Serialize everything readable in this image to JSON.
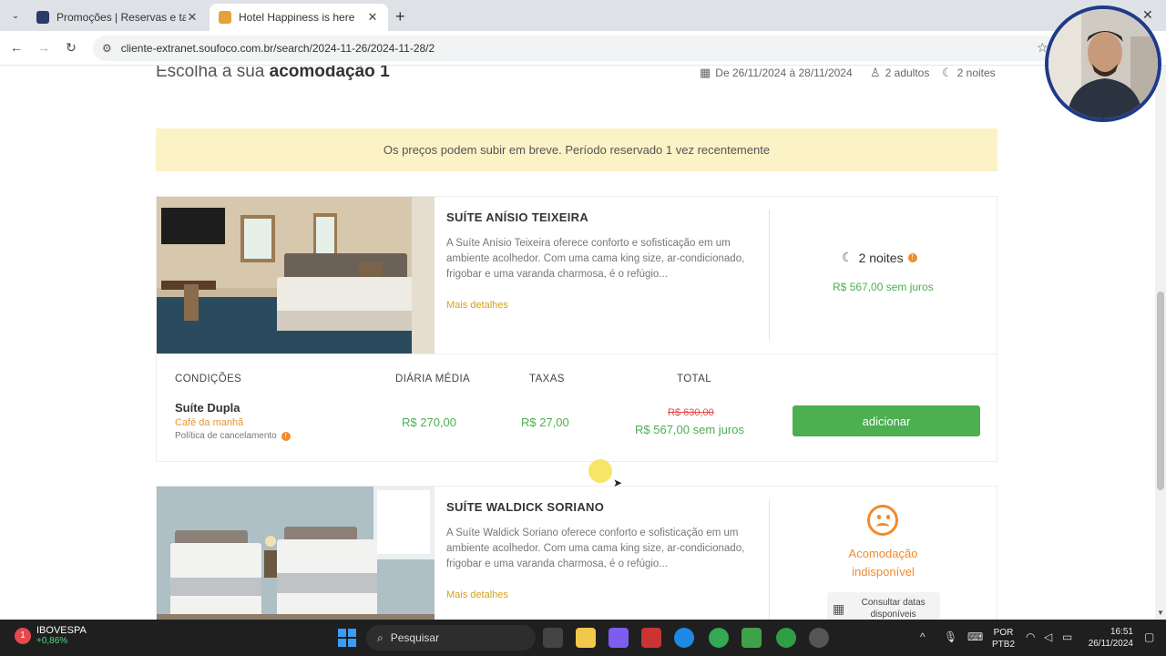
{
  "browser": {
    "tabs": [
      {
        "title": "Promoções | Reservas e tarifas",
        "active": false
      },
      {
        "title": "Hotel Happiness is here",
        "active": true
      }
    ],
    "url": "cliente-extranet.soufoco.com.br/search/2024-11-26/2024-11-28/2"
  },
  "page": {
    "heading_prefix": "Escolha a sua",
    "heading_bold": "acomodação 1",
    "date_range": "De 26/11/2024 à 28/11/2024",
    "guests": "2 adultos",
    "nights": "2 noites",
    "banner": "Os preços podem subir em breve. Período reservado 1 vez recentemente"
  },
  "rooms": [
    {
      "name": "SUÍTE ANÍSIO TEIXEIRA",
      "description": "A Suíte Anísio Teixeira oferece conforto e sofisticação em um ambiente acolhedor. Com uma cama king size, ar-condicionado, frigobar e uma varanda charmosa, é o refúgio...",
      "more_link": "Mais detalhes",
      "nights": "2 noites",
      "price_summary": "R$ 567,00 sem juros",
      "headers": {
        "conditions": "CONDIÇÕES",
        "daily": "DIÁRIA MÉDIA",
        "taxes": "TAXAS",
        "total": "TOTAL"
      },
      "condition_name": "Suíte Dupla",
      "meal": "Café da manhã",
      "policy": "Política de cancelamento",
      "daily": "R$ 270,00",
      "taxes": "R$ 27,00",
      "old_total": "R$ 630,00",
      "total": "R$ 567,00 sem juros",
      "add_button": "adicionar"
    },
    {
      "name": "SUÍTE WALDICK SORIANO",
      "description": "A Suíte Waldick Soriano oferece conforto e sofisticação em um ambiente acolhedor. Com uma cama king size, ar-condicionado, frigobar e uma varanda charmosa, é o refúgio...",
      "more_link": "Mais detalhes",
      "status": "Acomodação indisponível",
      "consult_button": "Consultar datas disponíveis"
    }
  ],
  "taskbar": {
    "stock_name": "IBOVESPA",
    "stock_change": "+0,86%",
    "search_placeholder": "Pesquisar",
    "lang": "POR",
    "lang_sub": "PTB2",
    "time": "16:51",
    "date": "26/11/2024"
  },
  "colors": {
    "accent_green": "#4caf50",
    "orange": "#f28a2e",
    "banner": "#fbf2c6"
  }
}
